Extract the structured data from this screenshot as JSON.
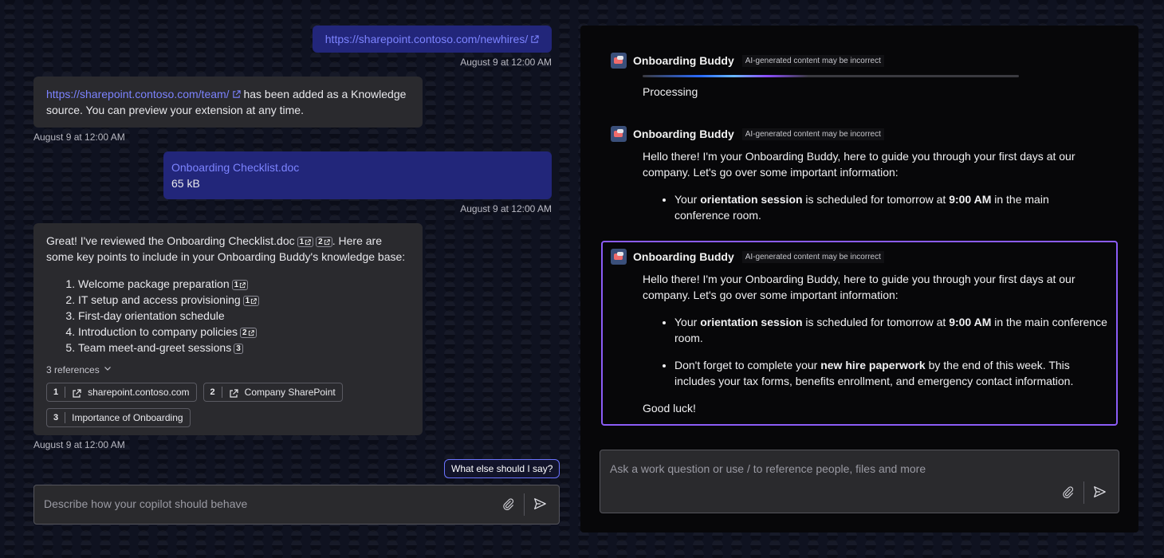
{
  "left": {
    "messages": [
      {
        "link": "https://sharepoint.contoso.com/newhires/",
        "timestamp": "August 9 at 12:00 AM"
      },
      {
        "link": "https://sharepoint.contoso.com/team/",
        "text": "has been added as a Knowledge source. You can preview your extension at any time.",
        "timestamp": "August 9 at 12:00 AM"
      },
      {
        "file_name": "Onboarding Checklist.doc",
        "file_size": "65 kB",
        "timestamp": "August 9 at 12:00 AM"
      },
      {
        "intro_a": "Great! I've reviewed the Onboarding Checklist.doc",
        "intro_b": ". Here are some key points to include in your Onboarding Buddy's knowledge base:",
        "points": [
          {
            "text": "Welcome package preparation",
            "cite": "1"
          },
          {
            "text": "IT setup and access provisioning",
            "cite": "1"
          },
          {
            "text": "First-day orientation schedule",
            "cite": ""
          },
          {
            "text": "Introduction to company policies",
            "cite": "2"
          },
          {
            "text": "Team meet-and-greet sessions",
            "cite": "3"
          }
        ],
        "references_label": "3 references",
        "references": [
          {
            "num": "1",
            "label": "sharepoint.contoso.com"
          },
          {
            "num": "2",
            "label": "Company SharePoint"
          },
          {
            "num": "3",
            "label": "Importance of Onboarding"
          }
        ],
        "timestamp": "August 9 at 12:00 AM"
      }
    ],
    "suggestion": "What else should I say?",
    "input_placeholder": "Describe how your copilot should behave"
  },
  "right": {
    "bot_name": "Onboarding Buddy",
    "ai_disclaimer": "AI-generated content may be incorrect",
    "processing_text": "Processing",
    "intro": "Hello there! I'm your Onboarding Buddy, here to guide you through your first days at our company. Let's go over some important information:",
    "bullet1": {
      "a": "Your ",
      "b": "orientation session",
      "c": " is scheduled for tomorrow at ",
      "d": "9:00 AM",
      "e": " in the main conference room."
    },
    "bullet2": {
      "a": "Don't forget to complete your ",
      "b": "new hire paperwork",
      "c": " by the end of this week. This includes your tax forms, benefits enrollment, and emergency contact information."
    },
    "closing": "Good luck!",
    "input_placeholder": "Ask a work question or use / to reference people, files and more"
  },
  "colors": {
    "accent": "#7c83ff",
    "user_bubble": "#22267a",
    "bot_bubble": "#2a2a2e",
    "focus_border": "#8b5cf6"
  },
  "icons": [
    "external-link-icon",
    "chevron-down-icon",
    "attach-icon",
    "send-icon",
    "bot-avatar-icon"
  ]
}
